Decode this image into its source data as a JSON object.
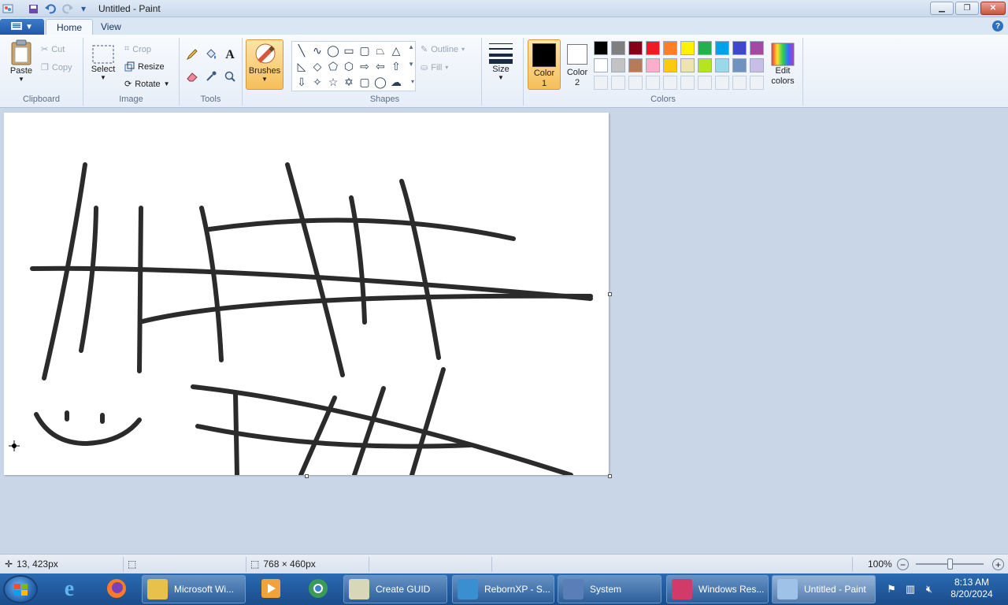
{
  "window": {
    "title": "Untitled - Paint"
  },
  "tabs": {
    "home": "Home",
    "view": "View"
  },
  "clipboard": {
    "paste": "Paste",
    "cut": "Cut",
    "copy": "Copy",
    "group": "Clipboard"
  },
  "image": {
    "select": "Select",
    "crop": "Crop",
    "resize": "Resize",
    "rotate": "Rotate",
    "group": "Image"
  },
  "tools": {
    "group": "Tools"
  },
  "brushes": {
    "label": "Brushes"
  },
  "shapes": {
    "outline": "Outline",
    "fill": "Fill",
    "group": "Shapes"
  },
  "size": {
    "label": "Size"
  },
  "colors": {
    "color1_line1": "Color",
    "color1_line2": "1",
    "color2_line1": "Color",
    "color2_line2": "2",
    "edit_line1": "Edit",
    "edit_line2": "colors",
    "group": "Colors",
    "color1_value": "#000000",
    "color2_value": "#ffffff",
    "palette_row1": [
      "#000000",
      "#7f7f7f",
      "#880015",
      "#ed1c24",
      "#ff7f27",
      "#fff200",
      "#22b14c",
      "#00a2e8",
      "#3f48cc",
      "#a349a4"
    ],
    "palette_row2": [
      "#ffffff",
      "#c3c3c3",
      "#b97a57",
      "#ffaec9",
      "#ffc90e",
      "#efe4b0",
      "#b5e61d",
      "#99d9ea",
      "#7092be",
      "#c8bfe7"
    ]
  },
  "status": {
    "cursor_pos": "13, 423px",
    "selection_size": "",
    "canvas_size": "768 × 460px",
    "zoom": "100%"
  },
  "taskbar": {
    "items": [
      {
        "label": "Microsoft Wi...",
        "icon_color": "#e8c14a"
      },
      {
        "label": "Create GUID",
        "icon_color": "#d8d8b8"
      },
      {
        "label": "RebornXP - S...",
        "icon_color": "#3a8fd0"
      },
      {
        "label": "System",
        "icon_color": "#5a7fb8"
      },
      {
        "label": "Windows Res...",
        "icon_color": "#d23a6a"
      },
      {
        "label": "Untitled - Paint",
        "icon_color": "#9fc3e8"
      }
    ],
    "clock_time": "8:13 AM",
    "clock_date": "8/20/2024"
  }
}
